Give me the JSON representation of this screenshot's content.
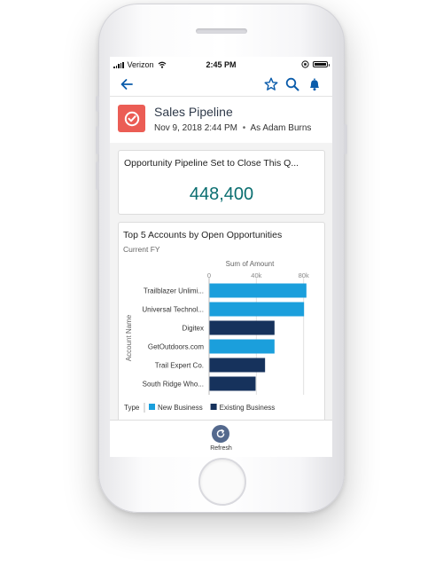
{
  "status_bar": {
    "carrier": "Verizon",
    "time": "2:45 PM"
  },
  "nav": {
    "back_icon": "arrow-left-icon",
    "favorite_icon": "star-icon",
    "search_icon": "search-icon",
    "notifications_icon": "bell-icon"
  },
  "header": {
    "title": "Sales Pipeline",
    "date": "Nov 9, 2018 2:44 PM",
    "separator": "•",
    "run_as": "As Adam Burns",
    "icon": "gauge-icon",
    "icon_color": "#EB5D55"
  },
  "metric_card": {
    "title": "Opportunity Pipeline Set to Close This Q...",
    "value": "448,400",
    "value_color": "#0A6E70"
  },
  "chart_card": {
    "title": "Top 5 Accounts by Open Opportunities",
    "subtitle": "Current FY"
  },
  "chart_data": {
    "type": "bar",
    "orientation": "horizontal",
    "xlabel": "Sum of Amount",
    "ylabel": "Account Name",
    "xlim": [
      0,
      90000
    ],
    "xticks": [
      "0",
      "40k",
      "80k"
    ],
    "xtick_values": [
      0,
      40000,
      80000
    ],
    "grid": true,
    "legend": {
      "title": "Type",
      "placement": "bottom",
      "entries": [
        {
          "name": "New Business",
          "color": "#1B9FDC"
        },
        {
          "name": "Existing Business",
          "color": "#16325C"
        }
      ]
    },
    "categories": [
      "Trailblazer Unlimi...",
      "Universal Technol...",
      "Digitex",
      "GetOutdoors.com",
      "Trail Expert Co.",
      "South Ridge Who..."
    ],
    "values": [
      82000,
      80000,
      55000,
      55000,
      47000,
      39000
    ],
    "types": [
      "New Business",
      "New Business",
      "Existing Business",
      "New Business",
      "Existing Business",
      "Existing Business"
    ]
  },
  "bottom_bar": {
    "refresh_label": "Refresh",
    "refresh_icon": "refresh-icon"
  }
}
